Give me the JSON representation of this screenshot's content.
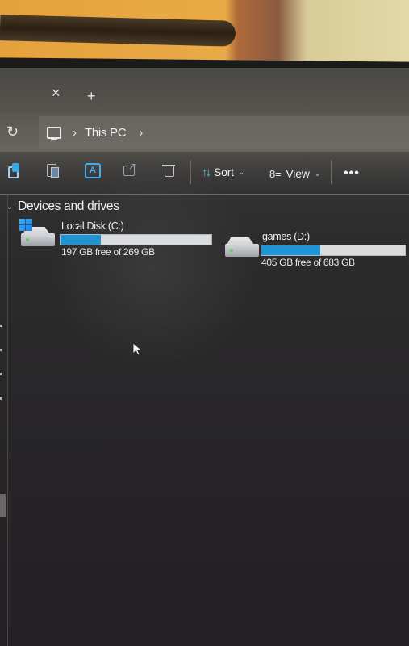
{
  "tabs": {
    "close_icon": "×",
    "new_tab_icon": "+"
  },
  "address_bar": {
    "refresh_icon": "↻",
    "location_icon": "pc-icon",
    "separator": "›",
    "breadcrumb": [
      "This PC"
    ],
    "trailing_separator": "›"
  },
  "command_bar": {
    "icons": [
      "copy-icon",
      "paste-icon",
      "rename-icon",
      "share-icon",
      "delete-icon"
    ],
    "sort_label": "Sort",
    "sort_icon": "↑↓",
    "view_label": "View",
    "view_icon": "8=",
    "dropdown_chevron": "⌄",
    "more_label": "•••"
  },
  "content": {
    "group": {
      "chevron": "⌄",
      "title": "Devices and drives"
    },
    "drives": [
      {
        "name": "Local Disk (C:)",
        "space_text": "197 GB free of 269 GB",
        "used_fraction": 0.27,
        "system_drive": true
      },
      {
        "name": "games (D:)",
        "space_text": "405 GB free of 683 GB",
        "used_fraction": 0.41,
        "system_drive": false
      }
    ]
  },
  "colors": {
    "accent": "#1f95d6",
    "bar_background": "#d9dbdd",
    "sort_icon": "#5cc0f4"
  },
  "nav_partial_text": ")"
}
